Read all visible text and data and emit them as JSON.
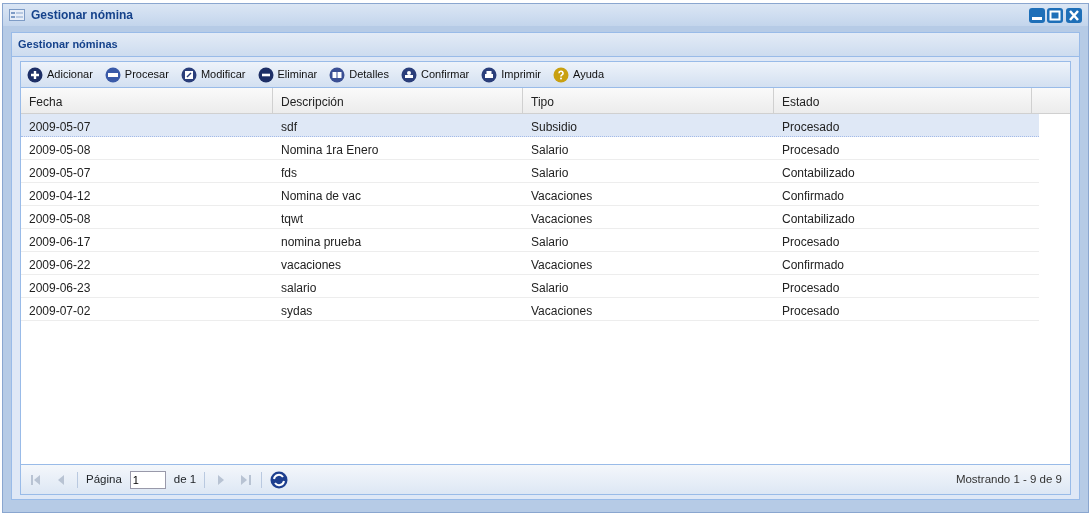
{
  "window": {
    "title": "Gestionar nómina"
  },
  "panel": {
    "title": "Gestionar nóminas"
  },
  "toolbar": [
    {
      "label": "Adicionar",
      "kind": "add"
    },
    {
      "label": "Procesar",
      "kind": "process"
    },
    {
      "label": "Modificar",
      "kind": "edit"
    },
    {
      "label": "Eliminar",
      "kind": "remove"
    },
    {
      "label": "Detalles",
      "kind": "details"
    },
    {
      "label": "Confirmar",
      "kind": "confirm"
    },
    {
      "label": "Imprimir",
      "kind": "print"
    },
    {
      "label": "Ayuda",
      "kind": "help"
    }
  ],
  "table": {
    "columns": [
      "Fecha",
      "Descripción",
      "Tipo",
      "Estado"
    ],
    "rows": [
      {
        "cells": [
          "2009-05-07",
          "sdf",
          "Subsidio",
          "Procesado"
        ],
        "selected": true
      },
      {
        "cells": [
          "2009-05-08",
          "Nomina 1ra Enero",
          "Salario",
          "Procesado"
        ],
        "selected": false
      },
      {
        "cells": [
          "2009-05-07",
          "fds",
          "Salario",
          "Contabilizado"
        ],
        "selected": false
      },
      {
        "cells": [
          "2009-04-12",
          "Nomina de vac",
          "Vacaciones",
          "Confirmado"
        ],
        "selected": false
      },
      {
        "cells": [
          "2009-05-08",
          "tqwt",
          "Vacaciones",
          "Contabilizado"
        ],
        "selected": false
      },
      {
        "cells": [
          "2009-06-17",
          "nomina prueba",
          "Salario",
          "Procesado"
        ],
        "selected": false
      },
      {
        "cells": [
          "2009-06-22",
          "vacaciones",
          "Vacaciones",
          "Confirmado"
        ],
        "selected": false
      },
      {
        "cells": [
          "2009-06-23",
          "salario",
          "Salario",
          "Procesado"
        ],
        "selected": false
      },
      {
        "cells": [
          "2009-07-02",
          "sydas",
          "Vacaciones",
          "Procesado"
        ],
        "selected": false
      }
    ]
  },
  "paging": {
    "page_label": "Página",
    "page_value": "1",
    "of_label": "de 1",
    "first_disabled": true,
    "prev_disabled": true,
    "next_disabled": true,
    "last_disabled": true,
    "summary": "Mostrando 1 - 9 de 9"
  }
}
